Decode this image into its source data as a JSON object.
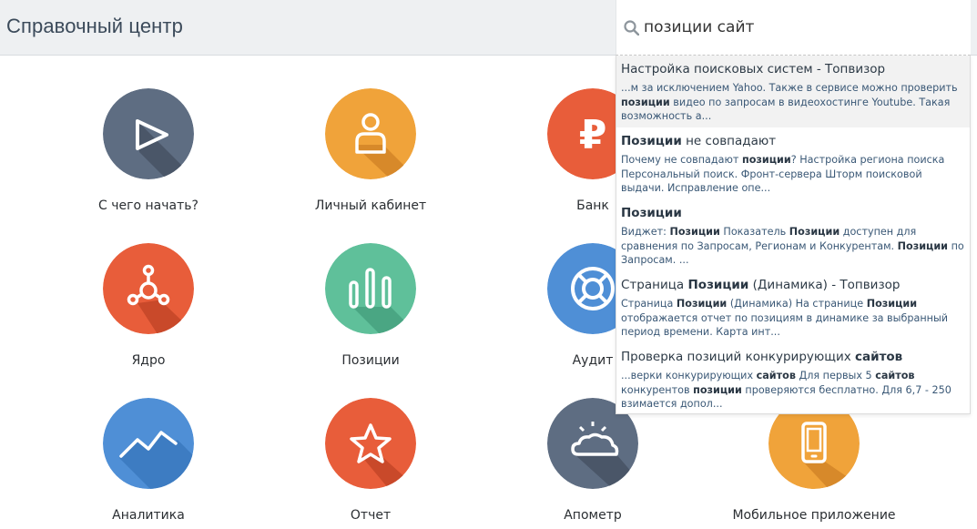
{
  "header": {
    "title": "Справочный центр"
  },
  "search": {
    "query": "позиции сайт",
    "results": [
      {
        "title": [
          "Настройка поисковых систем - Топвизор"
        ],
        "snippet": [
          "...м за исключением Yahoo. Также в сервисе можно проверить ",
          {
            "b": "позиции"
          },
          " видео по запросам в видеохостинге Youtube. Такая возможность а..."
        ]
      },
      {
        "title": [
          {
            "b": "Позиции"
          },
          " не совпадают"
        ],
        "snippet": [
          "Почему не совпадают ",
          {
            "b": "позиции"
          },
          "? Настройка региона поиска Персональный поиск. Фронт-сервера Шторм поисковой выдачи. Исправление опе..."
        ]
      },
      {
        "title": [
          {
            "b": "Позиции"
          }
        ],
        "snippet": [
          "Виджет: ",
          {
            "b": "Позиции"
          },
          " Показатель ",
          {
            "b": "Позиции"
          },
          " доступен для сравнения по Запросам, Регионам и Конкурентам. ",
          {
            "b": "Позиции"
          },
          " по Запросам. ..."
        ]
      },
      {
        "title": [
          "Страница ",
          {
            "b": "Позиции"
          },
          " (Динамика) - Топвизор"
        ],
        "snippet": [
          "Страница ",
          {
            "b": "Позиции"
          },
          " (Динамика) На странице ",
          {
            "b": "Позиции"
          },
          " отображается отчет по позициям в динамике за выбранный период времени. Карта инт..."
        ]
      },
      {
        "title": [
          "Проверка позиций конкурирующих ",
          {
            "b": "сайтов"
          }
        ],
        "snippet": [
          "...верки конкурирующих ",
          {
            "b": "сайтов"
          },
          " Для первых 5 ",
          {
            "b": "сайтов"
          },
          " конкурентов ",
          {
            "b": "позиции"
          },
          " проверяются бесплатно. Для 6,7 - 250 взимается допол..."
        ]
      }
    ]
  },
  "tiles": [
    {
      "label": "С чего начать?",
      "icon": "play-icon",
      "color": "#5e6d82"
    },
    {
      "label": "Личный кабинет",
      "icon": "user-icon",
      "color": "#f0a33a"
    },
    {
      "label": "Банк",
      "icon": "ruble-icon",
      "color": "#e85d3a"
    },
    {
      "label": "Ядро",
      "icon": "molecule-icon",
      "color": "#e85d3a"
    },
    {
      "label": "Позиции",
      "icon": "bars-icon",
      "color": "#5fc09a"
    },
    {
      "label": "Аудит",
      "icon": "lifebuoy-icon",
      "color": "#4f8fd6"
    },
    {
      "label": "Аналитика",
      "icon": "trend-icon",
      "color": "#4f8fd6"
    },
    {
      "label": "Отчет",
      "icon": "star-icon",
      "color": "#e85d3a"
    },
    {
      "label": "Апометр",
      "icon": "weather-icon",
      "color": "#5e6d82"
    },
    {
      "label": "Мобильное приложение",
      "icon": "phone-icon",
      "color": "#f0a33a"
    }
  ]
}
